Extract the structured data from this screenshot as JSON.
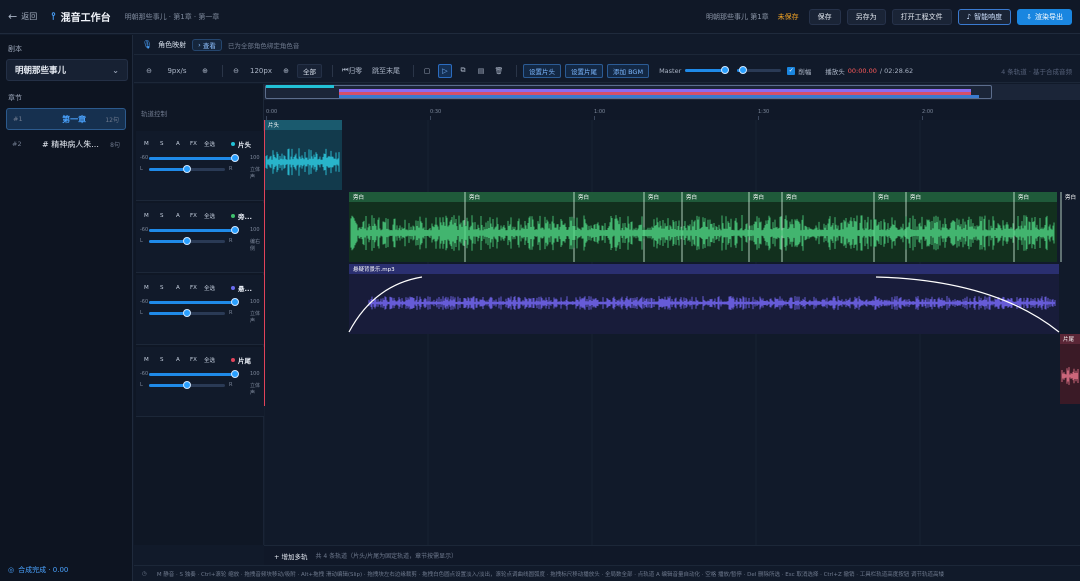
{
  "header": {
    "back_label": "返回",
    "app_title": "混音工作台",
    "breadcrumb": "明朝那些事儿 · 第1章 · 第一章",
    "project_name": "明朝那些事儿 第1章",
    "unsaved": "未保存",
    "save": "保存",
    "save_as": "另存为",
    "open_project": "打开工程文件",
    "smart_loudness": "智能响度",
    "render_export": "渲染导出"
  },
  "sidebar": {
    "script_label": "剧本",
    "script_value": "明朝那些事儿",
    "chapters_label": "章节",
    "chapters": [
      {
        "no": "#1",
        "name": "第一章",
        "count": "12句"
      },
      {
        "no": "#2",
        "name": "# 精神病人朱...",
        "count": "8句"
      }
    ],
    "status": "合成完成 · 0.00"
  },
  "role_bar": {
    "label": "角色映射",
    "view": "查看",
    "info": "已为全部角色绑定角色音"
  },
  "toolbar": {
    "zoom_px": "9px/s",
    "width_px": "120px",
    "fit": "全部",
    "reset": "归零",
    "to_end": "跳至末尾",
    "set_intro": "设置片头",
    "set_outro": "设置片尾",
    "add_bgm": "添加 BGM",
    "master": "Master",
    "clip": "削幅",
    "playhead_label": "播放头",
    "playhead_time": "00:00.00",
    "total_time": "/ 02:28.62",
    "track_info": "4 条轨道 · 基于合成音频"
  },
  "timeline": {
    "track_ctrl_label": "轨道控制",
    "ruler_ticks": [
      "0:00",
      "0:30",
      "1:00",
      "1:30",
      "2:00"
    ]
  },
  "tracks": [
    {
      "name": "片头",
      "color": "#22c1d6",
      "db": "100",
      "pan_label": "立体声",
      "clip_label": "片头"
    },
    {
      "name": "旁...",
      "color": "#3fc06d",
      "db": "100",
      "pan_label": "编右侧",
      "clip_labels": [
        "旁白",
        "旁白",
        "旁白",
        "旁白",
        "旁白",
        "旁白",
        "旁白",
        "旁白",
        "旁白",
        "旁白",
        "旁白",
        "旁白"
      ]
    },
    {
      "name": "悬...",
      "color": "#6b6cf0",
      "db": "100",
      "pan_label": "立体声",
      "clip_label": "悬疑背景乐.mp3"
    },
    {
      "name": "片尾",
      "color": "#e0435a",
      "db": "100",
      "pan_label": "立体声",
      "clip_label": "片尾"
    }
  ],
  "track_buttons": {
    "m": "M",
    "s": "S",
    "a": "A",
    "fx": "FX",
    "all": "全选",
    "vol_min": "-60",
    "pan_l": "L",
    "pan_r": "R"
  },
  "bottom": {
    "add_track": "+ 增加多轨",
    "hint": "共 4 条轨道（片头/片尾为固定轨道，章节按需显示）"
  },
  "footer": {
    "shortcuts": "M 静音 · S 独奏 · Ctrl+滚轮 缩放 · 拖拽音频块移动/吸附 · Alt+拖拽 滑动编辑(Slip) · 拖拽块左右边缘裁剪 · 拖拽白色圆点设置淡入/淡出，滚轮点调曲线圆弧度 · 拖拽标尺移动播放头 · 全局数全部 · 点轨道 A 编辑音量自动化 · 空格 播放/暂停 · Del 删除所选 · Esc 取消选择 · Ctrl+Z 撤销 · 工具栏轨道高度按钮 调节轨道高矮"
  },
  "colors": {
    "accent": "#1a86e0",
    "intro": "#22c1d6",
    "narration": "#3fc06d",
    "bgm": "#6b6cf0",
    "outro": "#e0435a",
    "unsaved": "#f5a524"
  }
}
